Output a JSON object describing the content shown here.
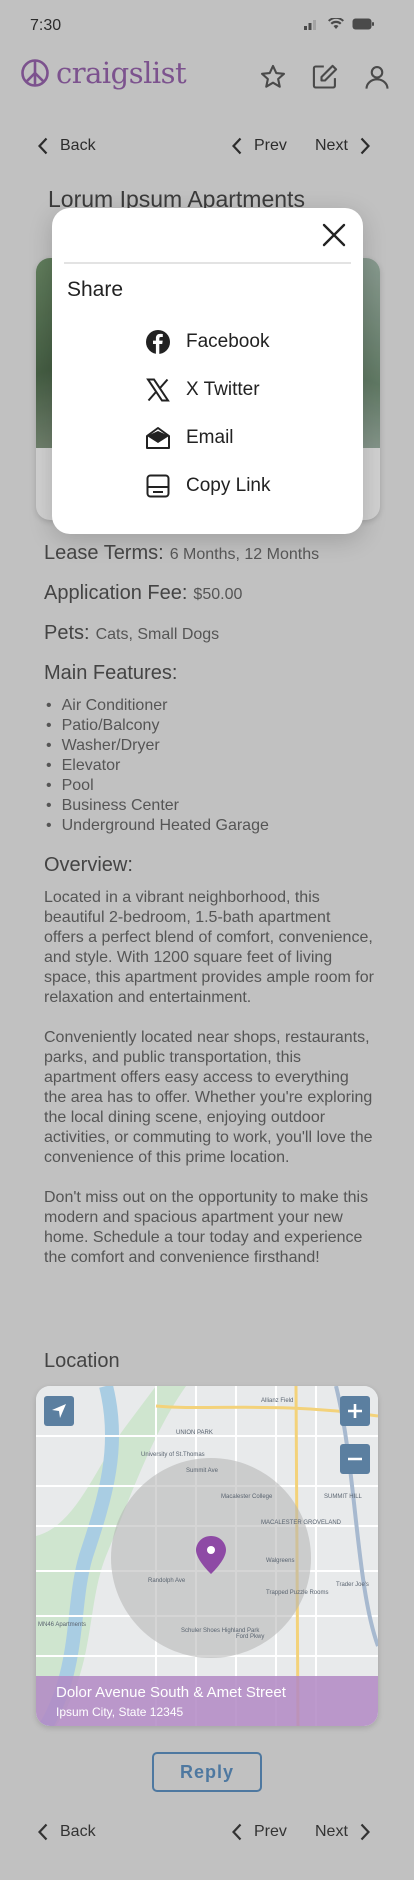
{
  "status": {
    "time": "7:30"
  },
  "app": {
    "name": "craigslist"
  },
  "pager": {
    "back": "Back",
    "prev": "Prev",
    "next": "Next"
  },
  "listing": {
    "title": "Lorum Ipsum Apartments"
  },
  "share_modal": {
    "title": "Share",
    "options": [
      {
        "label": "Facebook",
        "icon": "facebook-icon"
      },
      {
        "label": "X Twitter",
        "icon": "x-twitter-icon"
      },
      {
        "label": "Email",
        "icon": "email-icon"
      },
      {
        "label": "Copy Link",
        "icon": "copy-link-icon"
      }
    ]
  },
  "details": {
    "lease_label": "Lease Terms:",
    "lease_value": "6 Months, 12 Months",
    "fee_label": "Application Fee:",
    "fee_value": "$50.00",
    "pets_label": "Pets:",
    "pets_value": "Cats, Small Dogs"
  },
  "features": {
    "title": "Main Features:",
    "items": [
      "Air Conditioner",
      "Patio/Balcony",
      "Washer/Dryer",
      "Elevator",
      "Pool",
      "Business Center",
      "Underground Heated Garage"
    ]
  },
  "overview": {
    "title": "Overview:",
    "paragraphs": [
      "Located in a vibrant neighborhood, this beautiful 2-bedroom, 1.5-bath apartment offers a perfect blend of comfort, convenience, and style. With 1200 square feet of living space, this apartment provides ample room for relaxation and entertainment.",
      "Conveniently located near shops, restaurants, parks, and public transportation, this apartment offers easy access to everything the area has to offer. Whether you're exploring the local dining scene, enjoying outdoor activities, or commuting to work, you'll love the convenience of this prime location.",
      "Don't miss out on the opportunity to make this modern and spacious apartment your new home. Schedule a tour today and experience the comfort and convenience firsthand!"
    ]
  },
  "location": {
    "title": "Location",
    "street": "Dolor Avenue South & Amet Street",
    "city": "Ipsum City, State 12345",
    "map_labels": [
      "Allianz Field",
      "UNION PARK",
      "University of St.Thomas",
      "Summit Ave",
      "Macalester College",
      "MACALESTER GROVELAND",
      "Walgreens",
      "Trapped Puzzle Rooms",
      "Randolph Ave",
      "Schuler Shoes Highland Park",
      "Ford Pkwy",
      "MN46 Apartments",
      "Trader Joe's",
      "SUMMIT HILL"
    ]
  },
  "reply": {
    "label": "Reply"
  },
  "colors": {
    "brand": "#8e5ea2",
    "accent": "#4e78a0",
    "map_button": "#5b7fa0"
  }
}
